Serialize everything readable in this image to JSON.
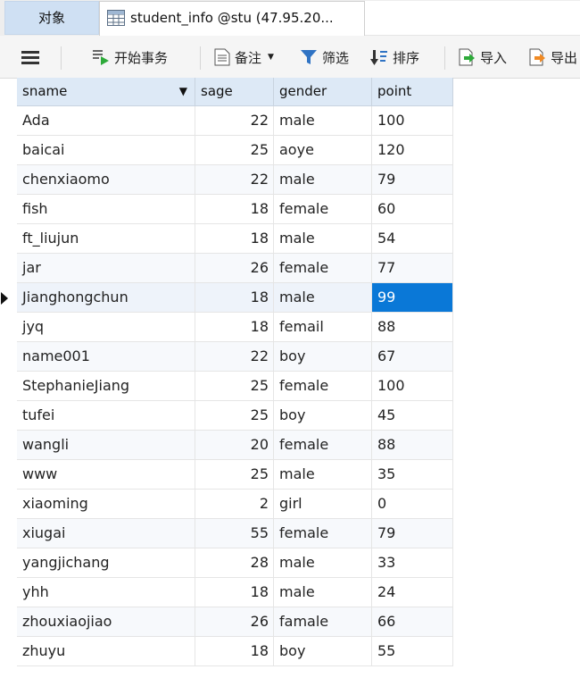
{
  "tabs": {
    "objects": "对象",
    "table": "student_info @stu (47.95.20..."
  },
  "toolbar": {
    "menu_icon": "hamburger-icon",
    "begin_transaction": "开始事务",
    "memo": "备注",
    "filter": "筛选",
    "sort": "排序",
    "import": "导入",
    "export": "导出"
  },
  "table": {
    "columns": [
      "sname",
      "sage",
      "gender",
      "point"
    ],
    "rows": [
      {
        "sname": "Ada",
        "sage": "22",
        "gender": "male",
        "point": "100"
      },
      {
        "sname": "baicai",
        "sage": "25",
        "gender": "aoye",
        "point": "120"
      },
      {
        "sname": "chenxiaomo",
        "sage": "22",
        "gender": "male",
        "point": "79"
      },
      {
        "sname": "fish",
        "sage": "18",
        "gender": "female",
        "point": "60"
      },
      {
        "sname": "ft_liujun",
        "sage": "18",
        "gender": "male",
        "point": "54"
      },
      {
        "sname": "jar",
        "sage": "26",
        "gender": "female",
        "point": "77"
      },
      {
        "sname": "Jianghongchun",
        "sage": "18",
        "gender": "male",
        "point": "99"
      },
      {
        "sname": "jyq",
        "sage": "18",
        "gender": "femail",
        "point": "88"
      },
      {
        "sname": "name001",
        "sage": "22",
        "gender": "boy",
        "point": "67"
      },
      {
        "sname": "StephanieJiang",
        "sage": "25",
        "gender": "female",
        "point": "100"
      },
      {
        "sname": "tufei",
        "sage": "25",
        "gender": "boy",
        "point": "45"
      },
      {
        "sname": "wangli",
        "sage": "20",
        "gender": "female",
        "point": "88"
      },
      {
        "sname": "www",
        "sage": "25",
        "gender": "male",
        "point": "35"
      },
      {
        "sname": "xiaoming",
        "sage": "2",
        "gender": "girl",
        "point": "0"
      },
      {
        "sname": "xiugai",
        "sage": "55",
        "gender": "female",
        "point": "79"
      },
      {
        "sname": "yangjichang",
        "sage": "28",
        "gender": "male",
        "point": "33"
      },
      {
        "sname": "yhh",
        "sage": "18",
        "gender": "male",
        "point": "24"
      },
      {
        "sname": "zhouxiaojiao",
        "sage": "26",
        "gender": "famale",
        "point": "66"
      },
      {
        "sname": "zhuyu",
        "sage": "18",
        "gender": "boy",
        "point": "55"
      }
    ],
    "selected_row": 6,
    "selected_column": "point"
  },
  "colors": {
    "selection": "#0a78d7",
    "header_bg": "#dde9f6",
    "tab_active_bg": "#cfe0f3"
  }
}
